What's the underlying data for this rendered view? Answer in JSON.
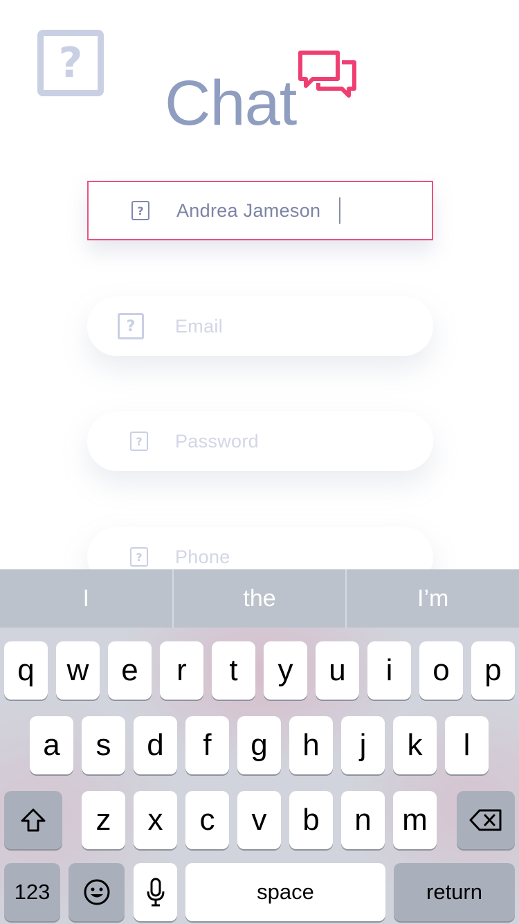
{
  "header": {
    "help_icon": "question-square-icon",
    "help_glyph": "?",
    "logo_text": "Chat",
    "logo_icon": "chat-bubbles-icon",
    "accent_color": "#ef3f72",
    "logo_color": "#8f9dc0"
  },
  "form": {
    "name": {
      "value": "Andrea Jameson",
      "icon": "question-square-icon",
      "glyph": "?"
    },
    "email": {
      "placeholder": "Email",
      "icon": "question-square-icon",
      "glyph": "?"
    },
    "password": {
      "placeholder": "Password",
      "icon": "question-square-icon",
      "glyph": "?"
    },
    "phone": {
      "placeholder": "Phone",
      "icon": "question-square-icon",
      "glyph": "?"
    }
  },
  "keyboard": {
    "suggestions": [
      "I",
      "the",
      "I’m"
    ],
    "row1": [
      "q",
      "w",
      "e",
      "r",
      "t",
      "y",
      "u",
      "i",
      "o",
      "p"
    ],
    "row2": [
      "a",
      "s",
      "d",
      "f",
      "g",
      "h",
      "j",
      "k",
      "l"
    ],
    "row3": [
      "z",
      "x",
      "c",
      "v",
      "b",
      "n",
      "m"
    ],
    "numbers_label": "123",
    "space_label": "space",
    "return_label": "return",
    "shift_icon": "shift-icon",
    "delete_icon": "backspace-icon",
    "emoji_icon": "emoji-icon",
    "mic_icon": "microphone-icon"
  }
}
